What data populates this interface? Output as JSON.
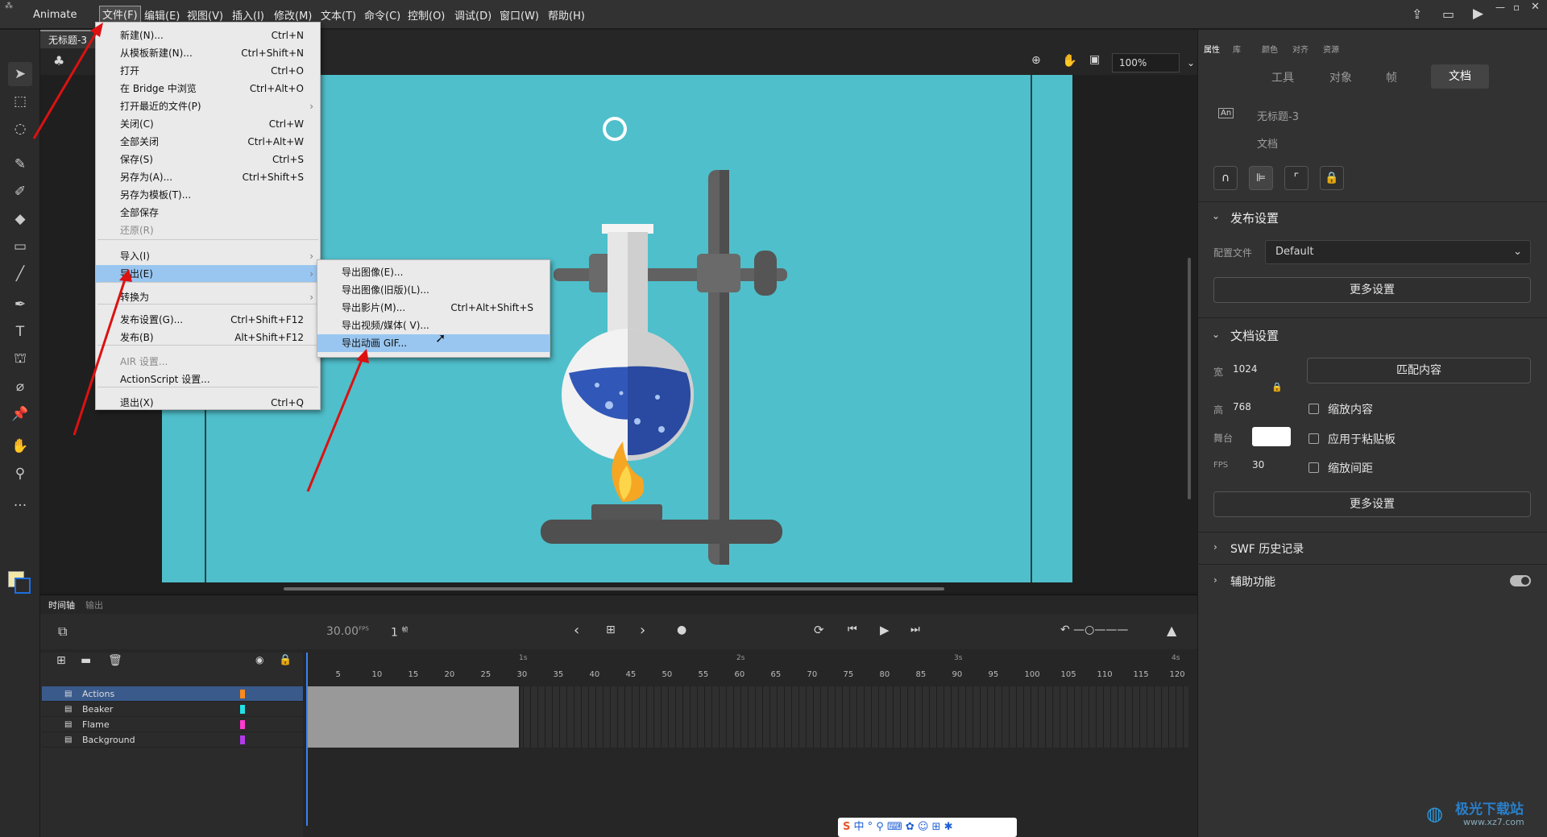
{
  "app": {
    "name": "Animate"
  },
  "menubar": [
    {
      "id": "file",
      "label": "文件(F)"
    },
    {
      "id": "edit",
      "label": "编辑(E)"
    },
    {
      "id": "view",
      "label": "视图(V)"
    },
    {
      "id": "insert",
      "label": "插入(I)"
    },
    {
      "id": "modify",
      "label": "修改(M)"
    },
    {
      "id": "text",
      "label": "文本(T)"
    },
    {
      "id": "commands",
      "label": "命令(C)"
    },
    {
      "id": "control",
      "label": "控制(O)"
    },
    {
      "id": "debug",
      "label": "调试(D)"
    },
    {
      "id": "window",
      "label": "窗口(W)"
    },
    {
      "id": "help",
      "label": "帮助(H)"
    }
  ],
  "document": {
    "tab": "无标题-3"
  },
  "stage": {
    "zoom": "100%",
    "bg": "#4fbfcb"
  },
  "file_menu": [
    {
      "label": "新建(N)...",
      "key": "Ctrl+N"
    },
    {
      "label": "从模板新建(N)...",
      "key": "Ctrl+Shift+N"
    },
    {
      "label": "打开",
      "key": "Ctrl+O"
    },
    {
      "label": "在 Bridge 中浏览",
      "key": "Ctrl+Alt+O"
    },
    {
      "label": "打开最近的文件(P)",
      "key": ""
    },
    {
      "label": "关闭(C)",
      "key": "Ctrl+W"
    },
    {
      "label": "全部关闭",
      "key": "Ctrl+Alt+W"
    },
    {
      "label": "保存(S)",
      "key": "Ctrl+S"
    },
    {
      "label": "另存为(A)...",
      "key": "Ctrl+Shift+S"
    },
    {
      "label": "另存为模板(T)...",
      "key": ""
    },
    {
      "label": "全部保存",
      "key": ""
    },
    {
      "label": "还原(R)",
      "key": ""
    },
    {
      "label": "导入(I)",
      "key": ""
    },
    {
      "label": "导出(E)",
      "key": ""
    },
    {
      "label": "转换为",
      "key": ""
    },
    {
      "label": "发布设置(G)...",
      "key": "Ctrl+Shift+F12"
    },
    {
      "label": "发布(B)",
      "key": "Alt+Shift+F12"
    },
    {
      "label": "AIR 设置...",
      "key": ""
    },
    {
      "label": "ActionScript 设置...",
      "key": ""
    },
    {
      "label": "退出(X)",
      "key": "Ctrl+Q"
    }
  ],
  "export_menu": [
    {
      "label": "导出图像(E)...",
      "key": ""
    },
    {
      "label": "导出图像(旧版)(L)...",
      "key": ""
    },
    {
      "label": "导出影片(M)...",
      "key": "Ctrl+Alt+Shift+S"
    },
    {
      "label": "导出视频/媒体( V)...",
      "key": ""
    },
    {
      "label": "导出动画 GIF...",
      "key": ""
    }
  ],
  "timeline": {
    "tab1": "时间轴",
    "tab2": "输出",
    "fps": "30.00",
    "fps_unit": "FPS",
    "frame": "1",
    "frame_unit": "帧",
    "seconds": [
      "1s",
      "2s",
      "3s",
      "4s"
    ],
    "ticks": [
      "5",
      "10",
      "15",
      "20",
      "25",
      "30",
      "35",
      "40",
      "45",
      "50",
      "55",
      "60",
      "65",
      "70",
      "75",
      "80",
      "85",
      "90",
      "95",
      "100",
      "105",
      "110",
      "115",
      "120"
    ],
    "layers": [
      {
        "name": "Actions",
        "color": "#ff8a1c"
      },
      {
        "name": "Beaker",
        "color": "#23e0e8"
      },
      {
        "name": "Flame",
        "color": "#ff3ad1"
      },
      {
        "name": "Background",
        "color": "#b23be8"
      }
    ]
  },
  "panel": {
    "tabs": [
      "属性",
      "库",
      "颜色",
      "对齐",
      "资源"
    ],
    "subtabs": [
      "工具",
      "对象",
      "帧",
      "文档"
    ],
    "doc_name": "无标题-3",
    "doc_type": "文档",
    "publish": {
      "title": "发布设置",
      "profile_label": "配置文件",
      "profile": "Default",
      "more": "更多设置"
    },
    "docset": {
      "title": "文档设置",
      "w_label": "宽",
      "w": "1024",
      "h_label": "高",
      "h": "768",
      "match": "匹配内容",
      "scale": "缩放内容",
      "stage_label": "舞台",
      "paste": "应用于粘贴板",
      "fps_label": "FPS",
      "fps": "30",
      "spacing": "缩放间距",
      "more": "更多设置"
    },
    "swf": "SWF 历史记录",
    "access": "辅助功能"
  },
  "watermark": {
    "text": "极光下载站",
    "url": "www.xz7.com"
  },
  "ime": {
    "label": "中"
  }
}
